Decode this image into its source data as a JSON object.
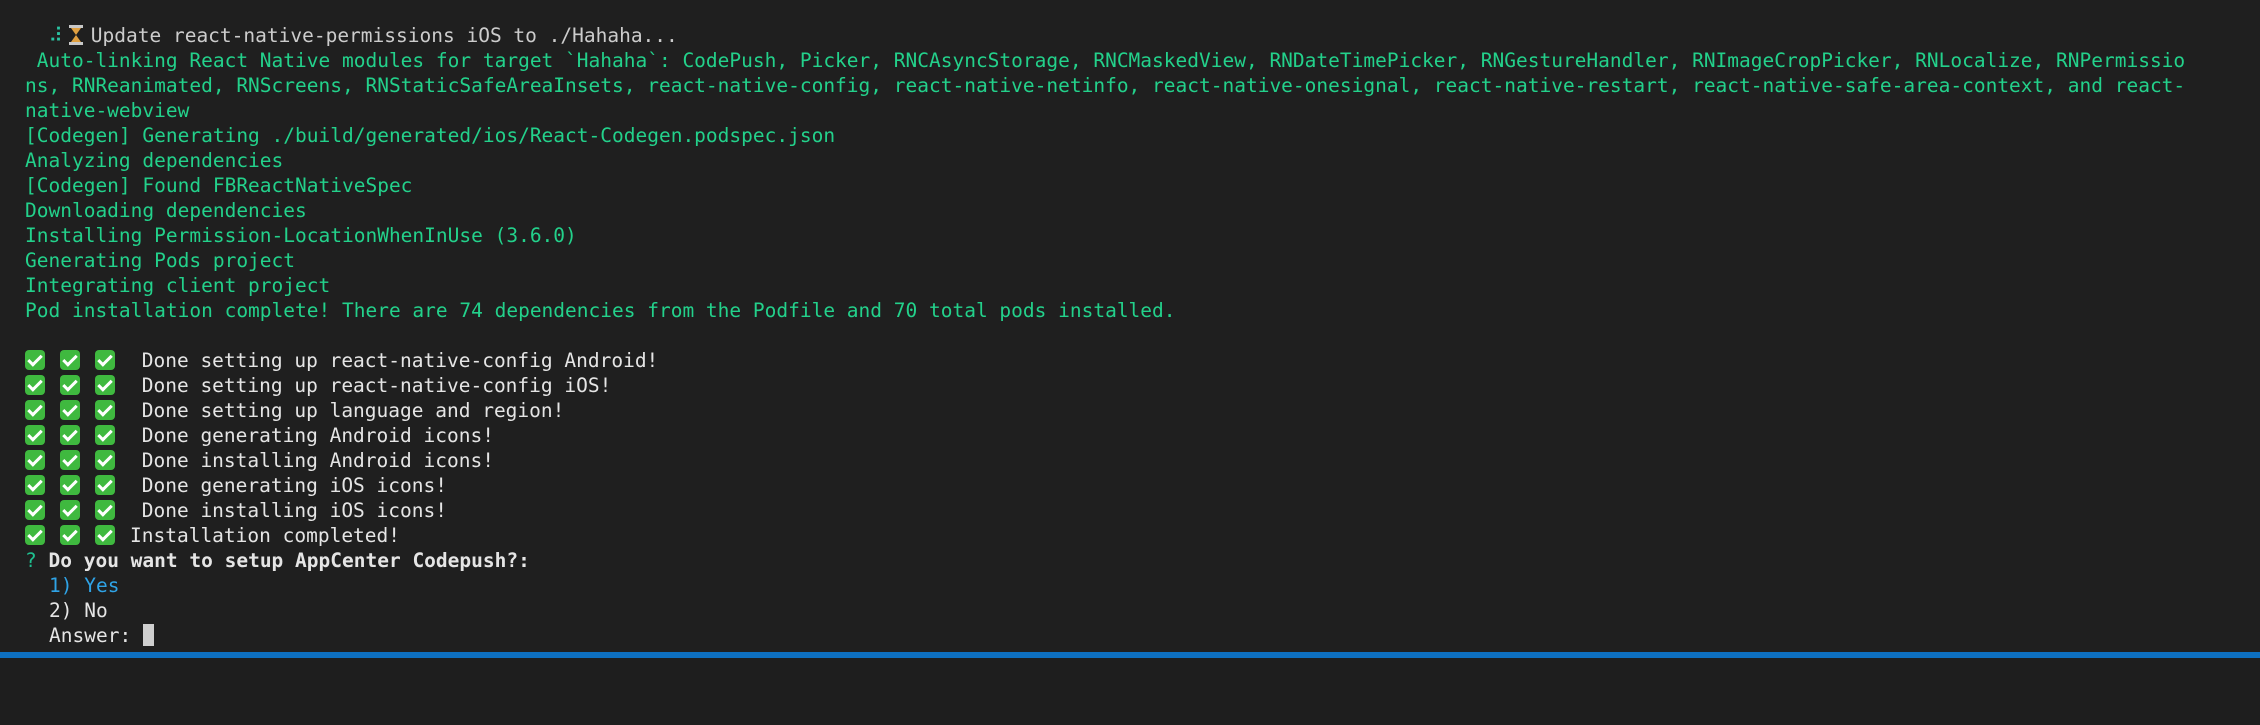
{
  "colors": {
    "background": "#1f1f1f",
    "output_green": "#23d18b",
    "option_selected": "#2fa3e6",
    "status_bar": "#0e70c0",
    "checkmark": "#3fb93f"
  },
  "icons": {
    "spinner": "spinner-icon",
    "hourglass": "hourglass-icon",
    "check": "check-mark-icon"
  },
  "header": {
    "spinner_char": "⠼",
    "task_text": "Update react-native-permissions iOS to ./Hahaha..."
  },
  "log": {
    "autolink_line1": " Auto-linking React Native modules for target `Hahaha`: CodePush, Picker, RNCAsyncStorage, RNCMaskedView, RNDateTimePicker, RNGestureHandler, RNImageCropPicker, RNLocalize, RNPermissio",
    "autolink_line2": "ns, RNReanimated, RNScreens, RNStaticSafeAreaInsets, react-native-config, react-native-netinfo, react-native-onesignal, react-native-restart, react-native-safe-area-context, and react-",
    "autolink_line3": "native-webview",
    "codegen_generating": "[Codegen] Generating ./build/generated/ios/React-Codegen.podspec.json",
    "analyzing": "Analyzing dependencies",
    "codegen_found": "[Codegen] Found FBReactNativeSpec",
    "downloading": "Downloading dependencies",
    "installing_permission": "Installing Permission-LocationWhenInUse (3.6.0)",
    "generating_pods": "Generating Pods project",
    "integrating": "Integrating client project",
    "pod_complete": "Pod installation complete! There are 74 dependencies from the Podfile and 70 total pods installed."
  },
  "done_steps": [
    " Done setting up react-native-config Android!",
    " Done setting up react-native-config iOS!",
    " Done setting up language and region!",
    " Done generating Android icons!",
    " Done installing Android icons!",
    " Done generating iOS icons!",
    " Done installing iOS icons!",
    "Installation completed!"
  ],
  "prompt": {
    "marker": "?",
    "question": "Do you want to setup AppCenter Codepush?:",
    "options": [
      "1) Yes",
      "2) No"
    ],
    "answer_label": "Answer: "
  }
}
